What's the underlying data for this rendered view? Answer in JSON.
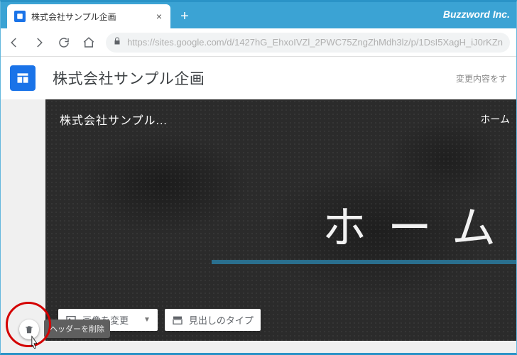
{
  "browser": {
    "tab_title": "株式会社サンプル企画",
    "brand": "Buzzword Inc.",
    "url": "https://sites.google.com/d/1427hG_EhxoIVZl_2PWC75ZngZhMdh3lz/p/1DsI5XagH_iJ0rKZn"
  },
  "app": {
    "site_title": "株式会社サンプル企画",
    "save_status": "変更内容をす"
  },
  "header": {
    "site_name": "株式会社サンプル...",
    "nav_home": "ホーム",
    "page_title": "ホーム",
    "delete_tooltip": "ヘッダーを削除"
  },
  "toolbar": {
    "change_image": "画像を変更",
    "heading_type": "見出しのタイプ"
  }
}
